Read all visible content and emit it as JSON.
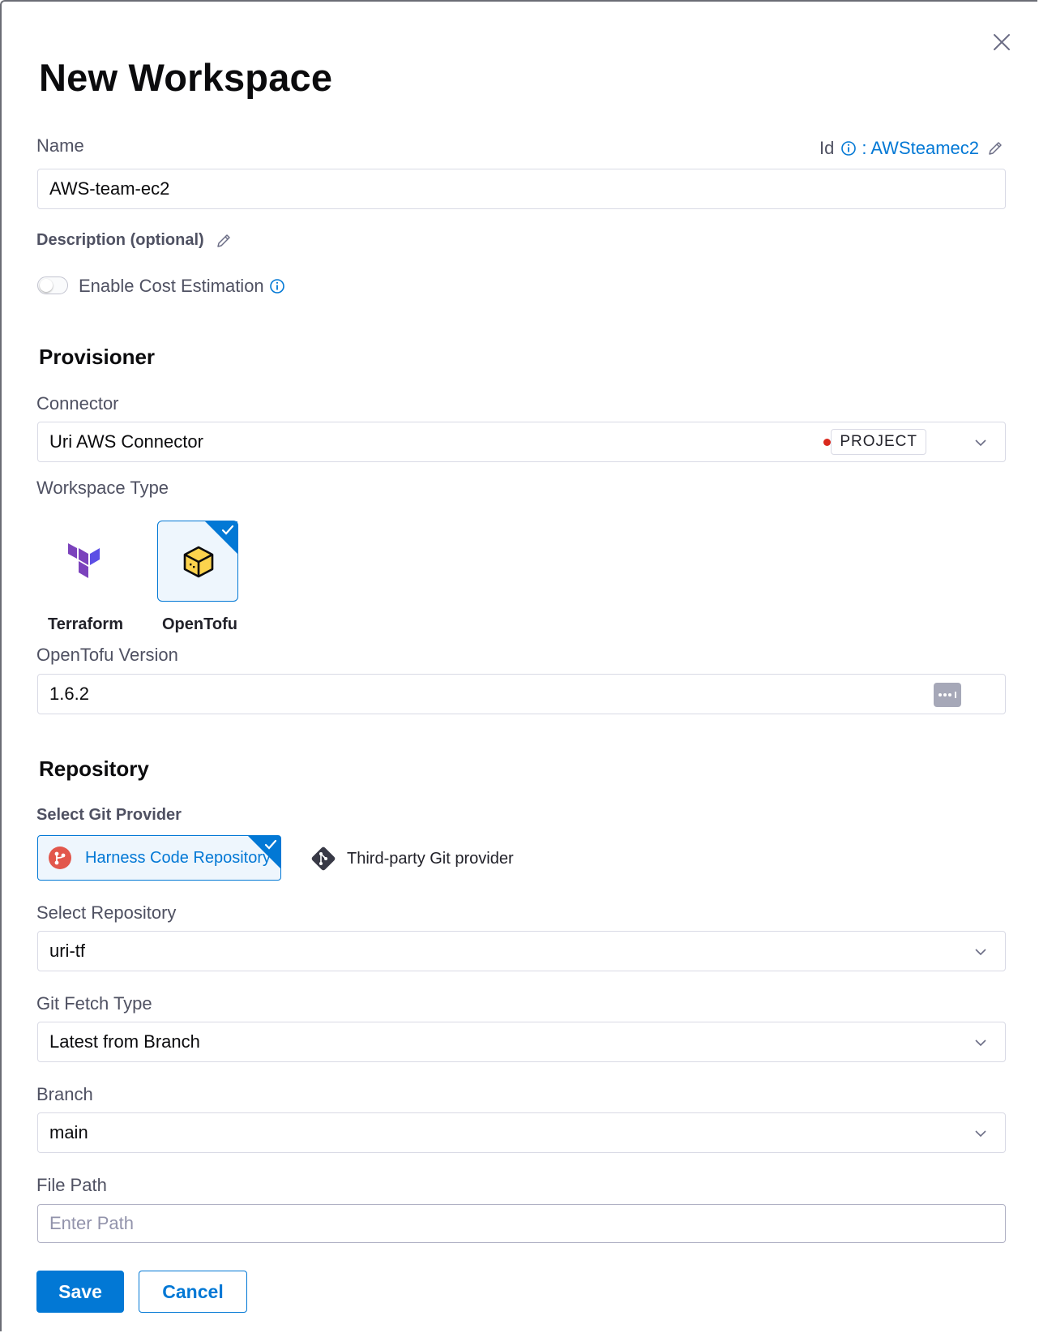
{
  "dialog": {
    "title": "New Workspace"
  },
  "name": {
    "label": "Name",
    "value": "AWS-team-ec2",
    "id_label": "Id",
    "id_value": ": AWSteamec2"
  },
  "description": {
    "label": "Description (optional)"
  },
  "cost_estimation": {
    "label": "Enable Cost Estimation",
    "enabled": false
  },
  "provisioner": {
    "section_title": "Provisioner",
    "connector_label": "Connector",
    "connector_value": "Uri AWS Connector",
    "connector_scope": "PROJECT",
    "workspace_type_label": "Workspace Type",
    "types": [
      {
        "label": "Terraform",
        "selected": false,
        "icon": "terraform-icon"
      },
      {
        "label": "OpenTofu",
        "selected": true,
        "icon": "opentofu-icon"
      }
    ],
    "version_label": "OpenTofu Version",
    "version_value": "1.6.2"
  },
  "repository": {
    "section_title": "Repository",
    "git_provider_label": "Select Git Provider",
    "providers": [
      {
        "label": "Harness Code Repository",
        "selected": true,
        "icon": "harness-code-icon"
      },
      {
        "label": "Third-party Git provider",
        "selected": false,
        "icon": "git-icon"
      }
    ],
    "select_repo_label": "Select Repository",
    "select_repo_value": "uri-tf",
    "fetch_type_label": "Git Fetch Type",
    "fetch_type_value": "Latest from Branch",
    "branch_label": "Branch",
    "branch_value": "main",
    "file_path_label": "File Path",
    "file_path_placeholder": "Enter  Path"
  },
  "actions": {
    "save_label": "Save",
    "cancel_label": "Cancel"
  },
  "colors": {
    "accent": "#0278d5",
    "selected_bg": "#eef6fd",
    "label": "#4f5162",
    "scope_dot": "#da291d"
  }
}
